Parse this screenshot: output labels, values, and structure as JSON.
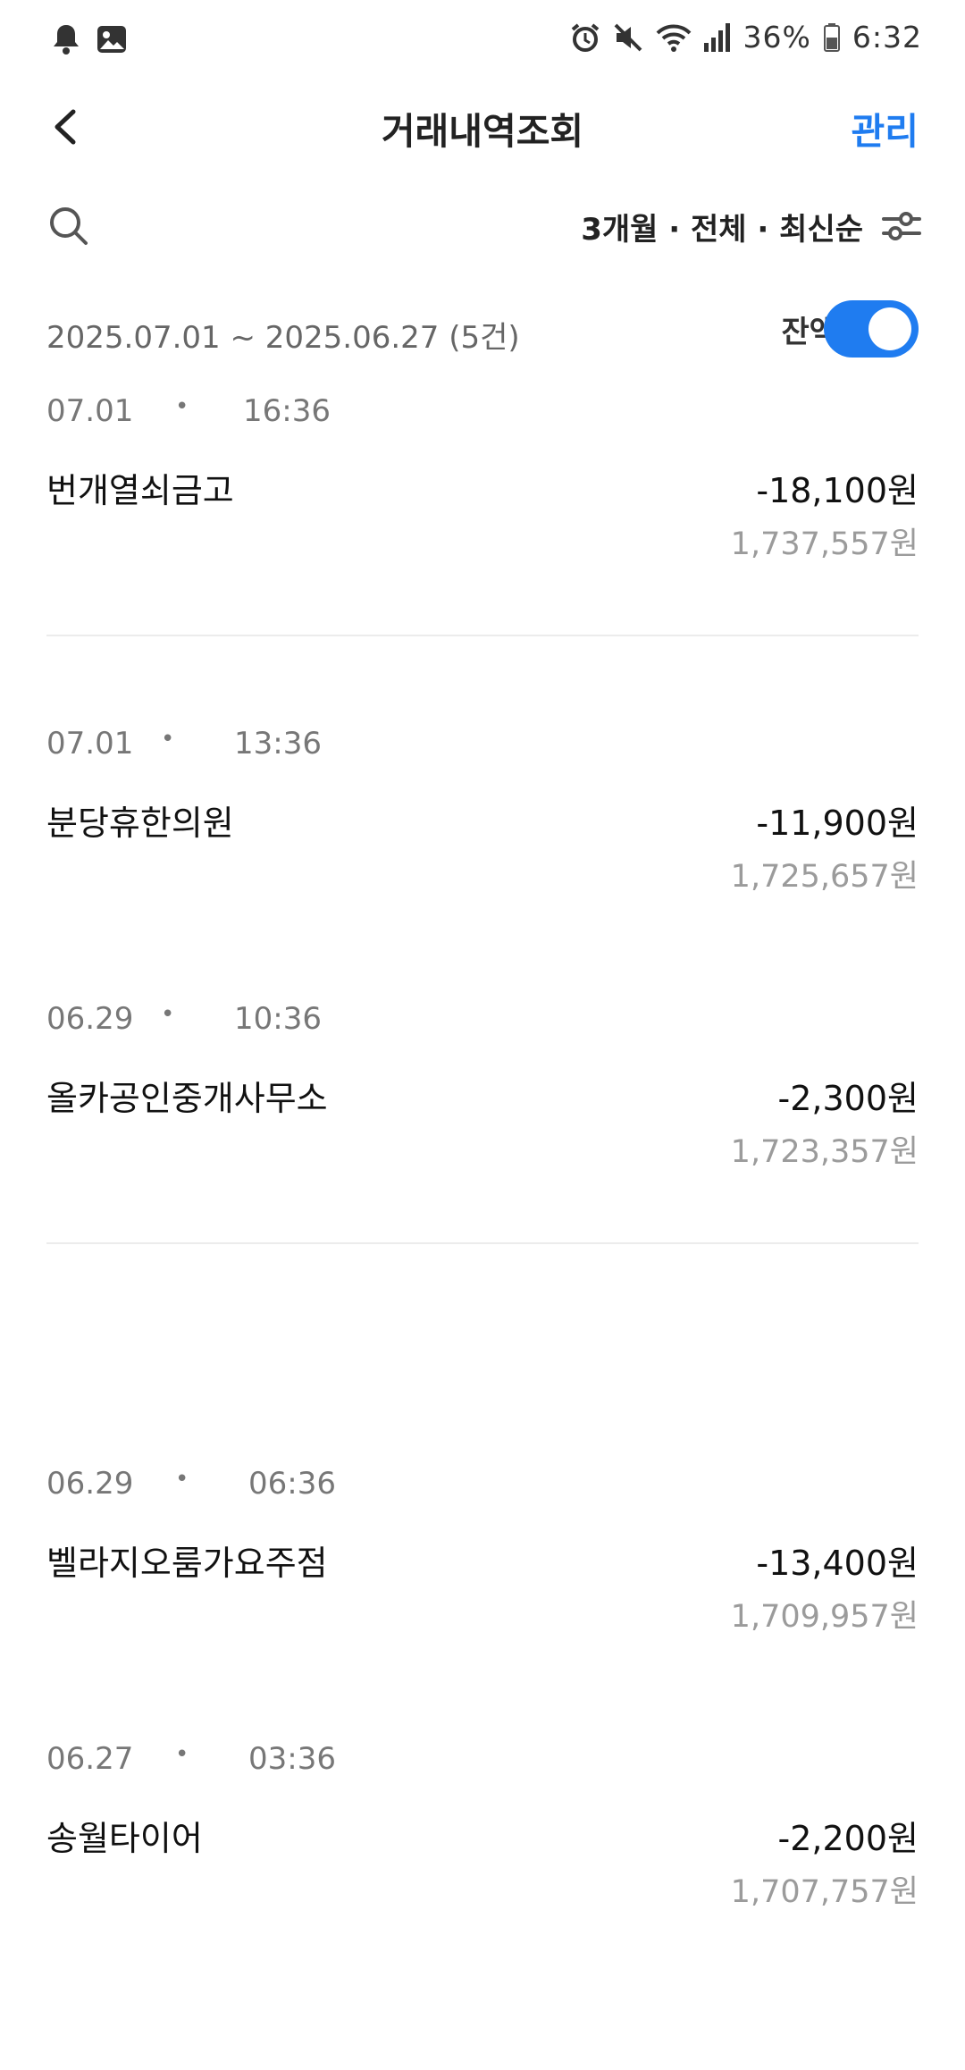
{
  "status_bar": {
    "battery": "36%",
    "time": "6:32",
    "icons": [
      "bell-icon",
      "image-icon",
      "alarm-icon",
      "mute-icon",
      "wifi-icon",
      "signal-icon",
      "battery-icon"
    ]
  },
  "header": {
    "title": "거래내역조회",
    "manage_label": "관리"
  },
  "filter": {
    "label": "3개월 · 전체 · 최신순"
  },
  "range": {
    "text": "2025.07.01 ~ 2025.06.27 (5건)",
    "balance_label": "잔액",
    "balance_toggle_on": true
  },
  "transactions": [
    {
      "date": "07.01",
      "time": "16:36",
      "name": "번개열쇠금고",
      "amount": "-18,100원",
      "balance": "1,737,557원"
    },
    {
      "date": "07.01",
      "time": "13:36",
      "name": "분당휴한의원",
      "amount": "-11,900원",
      "balance": "1,725,657원"
    },
    {
      "date": "06.29",
      "time": "10:36",
      "name": "올카공인중개사무소",
      "amount": "-2,300원",
      "balance": "1,723,357원"
    },
    {
      "date": "06.29",
      "time": "06:36",
      "name": "벨라지오룸가요주점",
      "amount": "-13,400원",
      "balance": "1,709,957원"
    },
    {
      "date": "06.27",
      "time": "03:36",
      "name": "송월타이어",
      "amount": "-2,200원",
      "balance": "1,707,757원"
    }
  ],
  "colors": {
    "accent": "#1f7cf0",
    "muted": "#9b9b9b"
  }
}
